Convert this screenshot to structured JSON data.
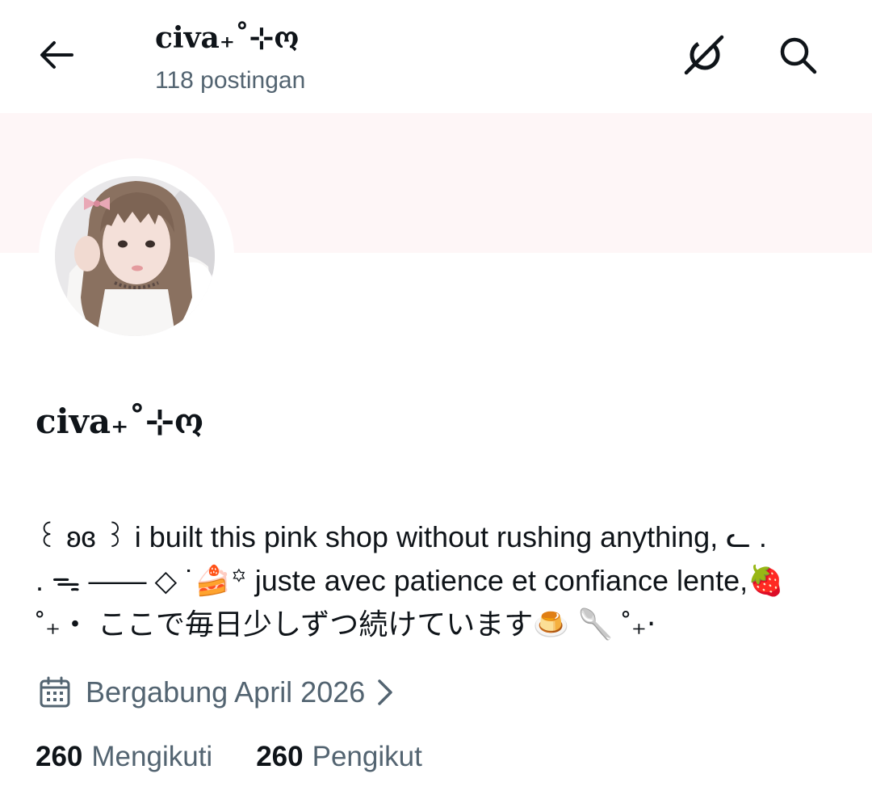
{
  "header": {
    "title": "civa₊˚⊹ო",
    "post_count": "118 postingan",
    "back_icon": "arrow-left-icon",
    "grok_icon": "grok-icon",
    "search_icon": "search-icon"
  },
  "banner": {
    "color": "#fef6f7"
  },
  "profile": {
    "display_name": "civa₊˚⊹ო",
    "bio": [
      "꒰ ʚɞ ꒱ i built this pink shop without rushing anything, ᓚ .",
      ". ᯓ ——  ◇ ˙🍰꙳ juste avec patience et confiance lente,🍓",
      "˚₊‧ ここで毎日少しずつ続けています🍮 🥄 ˚₊‧"
    ],
    "joined": "Bergabung April 2026",
    "calendar_icon": "calendar-icon",
    "chevron_icon": "chevron-right-icon"
  },
  "stats": {
    "following_count": "260",
    "following_label": "Mengikuti",
    "followers_count": "260",
    "followers_label": "Pengikut"
  },
  "colors": {
    "text_primary": "#0f1419",
    "text_secondary": "#536471",
    "background": "#ffffff"
  }
}
